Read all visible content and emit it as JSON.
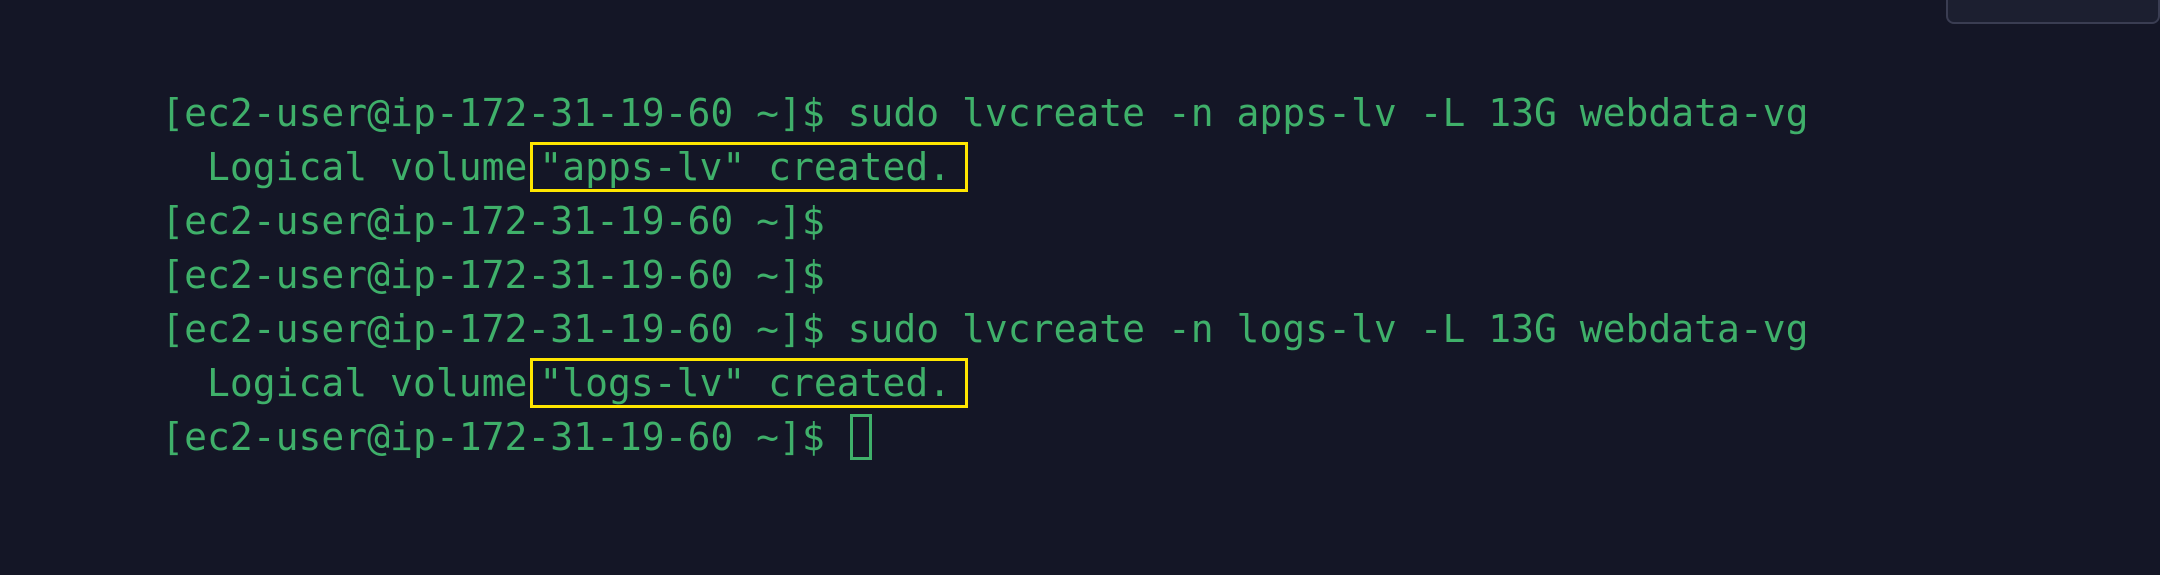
{
  "terminal": {
    "lines": [
      {
        "prompt": "[ec2-user@ip-172-31-19-60 ~]$",
        "command": " sudo lvcreate -n apps-lv -L 13G webdata-vg"
      },
      {
        "prefix": "  Logical volume",
        "highlight": "\"apps-lv\" created."
      },
      {
        "prompt": "[ec2-user@ip-172-31-19-60 ~]$",
        "command": ""
      },
      {
        "prompt": "[ec2-user@ip-172-31-19-60 ~]$",
        "command": ""
      },
      {
        "prompt": "[ec2-user@ip-172-31-19-60 ~]$",
        "command": " sudo lvcreate -n logs-lv -L 13G webdata-vg"
      },
      {
        "prefix": "  Logical volume",
        "highlight": "\"logs-lv\" created."
      },
      {
        "prompt": "[ec2-user@ip-172-31-19-60 ~]$",
        "command": " "
      }
    ]
  },
  "colors": {
    "background": "#141626",
    "text": "#3fb06a",
    "highlight_box": "#ffe600"
  }
}
